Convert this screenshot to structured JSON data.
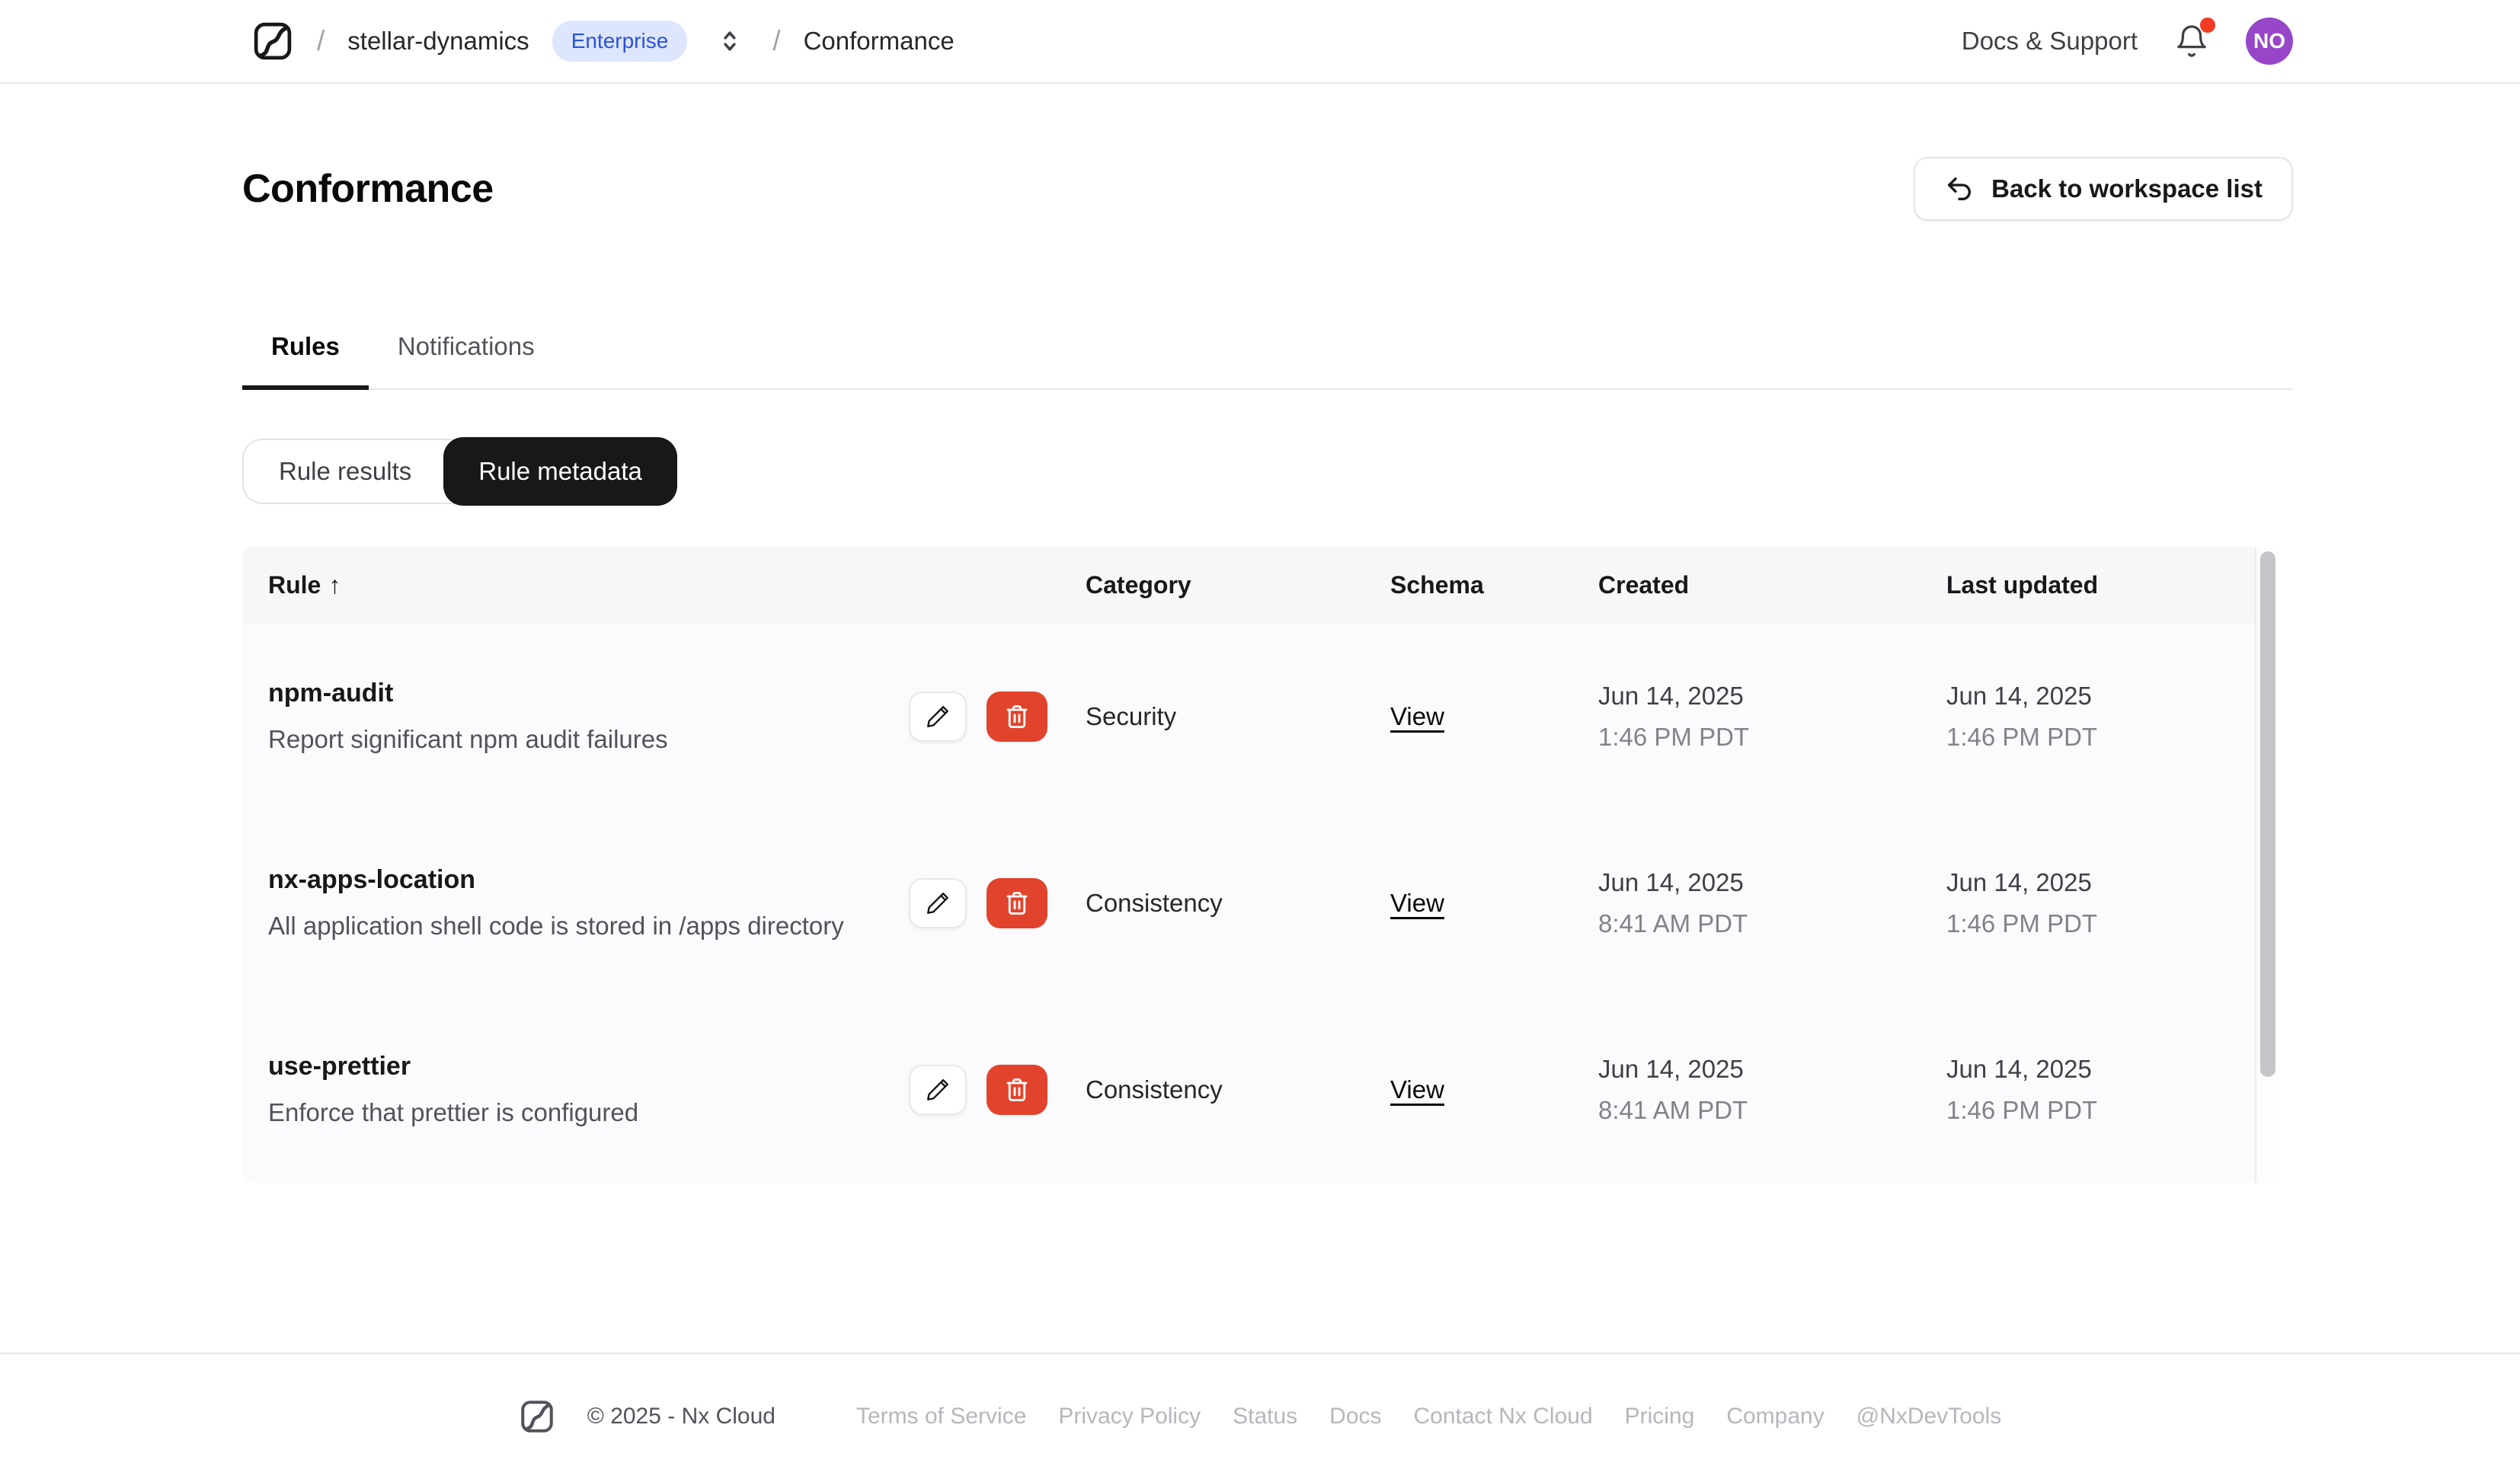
{
  "nav": {
    "separator": "/",
    "workspace": "stellar-dynamics",
    "workspace_badge": "Enterprise",
    "page": "Conformance",
    "docs_support": "Docs & Support",
    "avatar_initials": "NO"
  },
  "page": {
    "title": "Conformance",
    "back_button": "Back to workspace list"
  },
  "tabs": {
    "rules": "Rules",
    "notifications": "Notifications",
    "active": "Rules"
  },
  "toggle": {
    "results": "Rule results",
    "metadata": "Rule metadata",
    "active": "Rule metadata"
  },
  "table": {
    "sort_indicator": "↑",
    "columns": {
      "rule": "Rule",
      "category": "Category",
      "schema": "Schema",
      "created": "Created",
      "last_updated": "Last updated"
    },
    "rows": [
      {
        "name": "npm-audit",
        "description": "Report significant npm audit failures",
        "category": "Security",
        "schema_link": "View",
        "created_date": "Jun 14, 2025",
        "created_time": "1:46 PM PDT",
        "updated_date": "Jun 14, 2025",
        "updated_time": "1:46 PM PDT"
      },
      {
        "name": "nx-apps-location",
        "description": "All application shell code is stored in /apps directory",
        "category": "Consistency",
        "schema_link": "View",
        "created_date": "Jun 14, 2025",
        "created_time": "8:41 AM PDT",
        "updated_date": "Jun 14, 2025",
        "updated_time": "1:46 PM PDT"
      },
      {
        "name": "use-prettier",
        "description": "Enforce that prettier is configured",
        "category": "Consistency",
        "schema_link": "View",
        "created_date": "Jun 14, 2025",
        "created_time": "8:41 AM PDT",
        "updated_date": "Jun 14, 2025",
        "updated_time": "1:46 PM PDT"
      }
    ]
  },
  "footer": {
    "copyright": "© 2025 - Nx Cloud",
    "links": [
      "Terms of Service",
      "Privacy Policy",
      "Status",
      "Docs",
      "Contact Nx Cloud",
      "Pricing",
      "Company",
      "@NxDevTools"
    ]
  },
  "colors": {
    "badge_bg": "#dde6fd",
    "badge_text": "#2a52dd",
    "delete_button": "#e2432c",
    "avatar_bg": "#9646c7",
    "notification_dot": "#f13a1f",
    "active_toggle_bg": "#18181b"
  }
}
